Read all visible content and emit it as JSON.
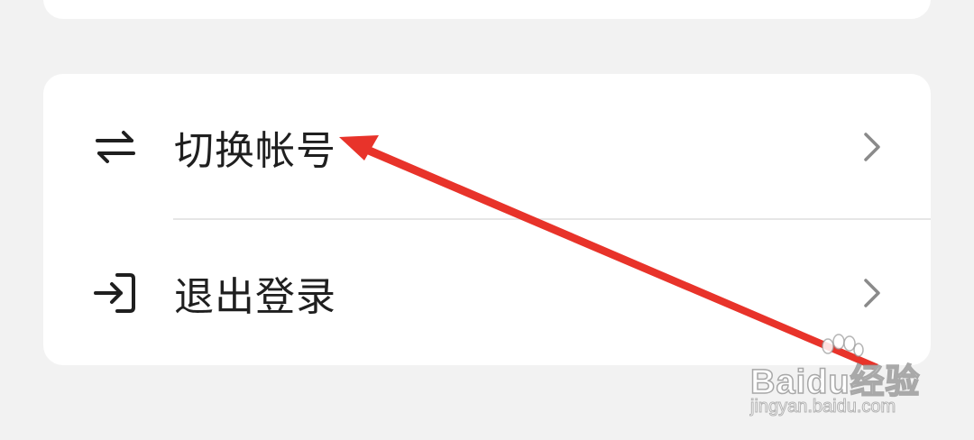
{
  "menu": {
    "items": [
      {
        "label": "切换帐号",
        "icon": "switch-arrows-icon",
        "trailing_icon": "chevron-right-icon"
      },
      {
        "label": "退出登录",
        "icon": "logout-icon",
        "trailing_icon": "chevron-right-icon"
      }
    ]
  },
  "annotation": {
    "type": "red-arrow",
    "points_to": "切换帐号",
    "color": "#e8332a"
  },
  "watermark": {
    "logo_text": "Baidu经验",
    "url_text": "jingyan.baidu.com"
  },
  "colors": {
    "background": "#f2f2f2",
    "card": "#ffffff",
    "text": "#1f1f1f",
    "chevron": "#8a8a8a",
    "divider": "#e6e6e6"
  }
}
